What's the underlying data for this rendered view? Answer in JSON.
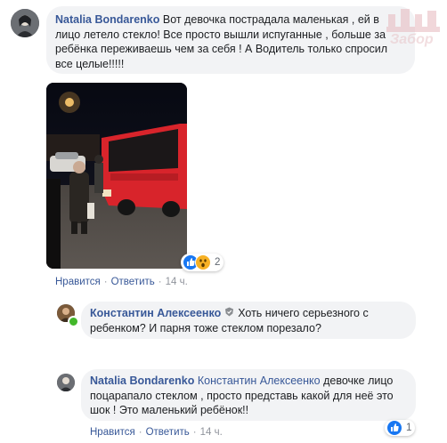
{
  "comment1": {
    "author": "Natalia Bondarenko",
    "text_lines": [
      "Вот девочка пострадала маленькая , ей в",
      "лицо летело стекло! Все просто вышли испуганные , больше за",
      "ребёнка переживаешь чем за себя ! А Водитель только спросил",
      "все целые!!!!!"
    ],
    "reaction_count": "2",
    "actions": {
      "like": "Нравится",
      "reply": "Ответить",
      "time": "14 ч."
    }
  },
  "reply1": {
    "author": "Константин Алексеенко",
    "text_lines": [
      "Хоть ничего серьезного с",
      "ребенком? И парня тоже стеклом порезало?"
    ]
  },
  "reply2": {
    "author": "Natalia Bondarenko",
    "mention": "Константин Алексеенко",
    "text_lines": [
      "девочке лицо",
      "поцарапало стеклом , просто представь какой для неё это",
      "шок ! Это маленький ребёнок!!"
    ],
    "reaction_count": "1",
    "actions": {
      "like": "Нравится",
      "reply": "Ответить",
      "time": "14 ч."
    }
  },
  "watermark": "Забор",
  "colors": {
    "link": "#385898",
    "bubble": "#f2f3f5",
    "like": "#1877f2",
    "online": "#42b72a"
  },
  "icons": {
    "like": "thumbs-up-icon",
    "wow": "wow-face-icon",
    "badge": "top-fan-badge-icon"
  }
}
